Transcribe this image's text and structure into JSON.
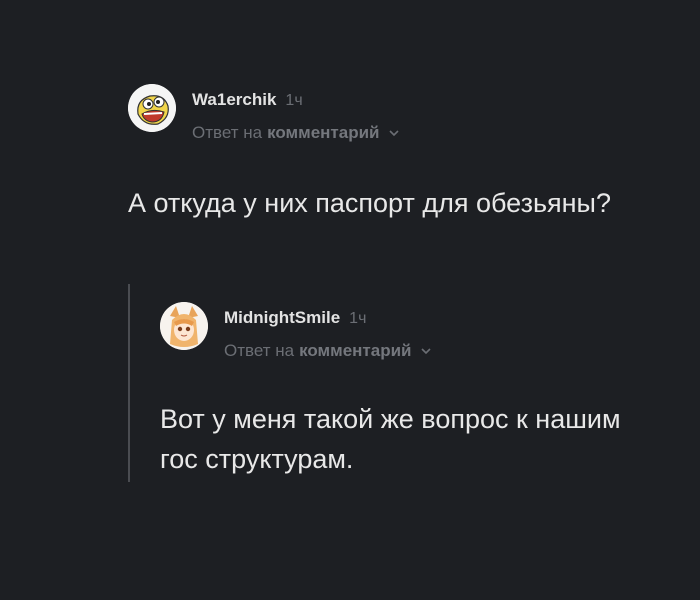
{
  "comments": [
    {
      "username": "Wa1erchik",
      "time": "1ч",
      "reply_prefix": "Ответ на",
      "reply_target": "комментарий",
      "text": "А откуда у них паспорт для обезьяны?",
      "avatar_icon": "cartoon-face-avatar-icon"
    },
    {
      "username": "MidnightSmile",
      "time": "1ч",
      "reply_prefix": "Ответ на",
      "reply_target": "комментарий",
      "text": "Вот у меня такой же вопрос к нашим гос структурам.",
      "avatar_icon": "anime-fox-girl-avatar-icon"
    }
  ],
  "colors": {
    "background": "#1d1f23",
    "text": "#e8e8e8",
    "muted": "#6b6e74",
    "thread_line": "#4a4c51"
  }
}
